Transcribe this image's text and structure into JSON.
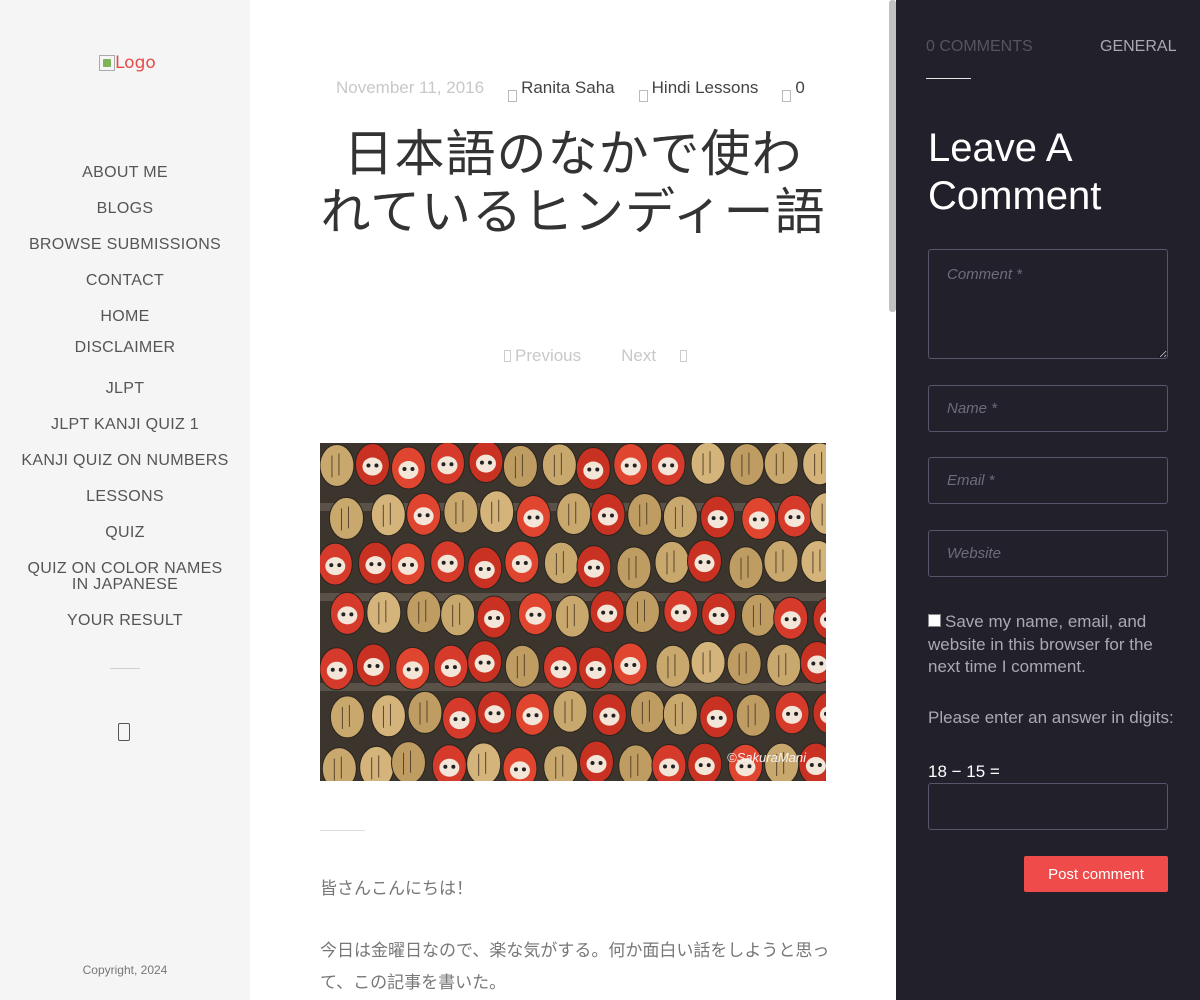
{
  "sidebar": {
    "logo_alt": "Logo",
    "nav": [
      "ABOUT ME",
      "BLOGS",
      "BROWSE SUBMISSIONS",
      "CONTACT",
      "HOME",
      "DISCLAIMER",
      "JLPT",
      "JLPT KANJI QUIZ 1",
      "KANJI QUIZ ON NUMBERS",
      "LESSONS",
      "QUIZ",
      "QUIZ ON COLOR NAMES IN JAPANESE",
      "YOUR RESULT"
    ],
    "icon": "mobile-icon",
    "copyright": "Copyright, 2024"
  },
  "post": {
    "date": "November 11, 2016",
    "author": "Ranita Saha",
    "category": "Hindi Lessons",
    "comment_count": "0",
    "title": "日本語のなかで使われているヒンディー語",
    "nav_previous": "Previous",
    "nav_next": "Next",
    "photo_credit": "©SakuraMani",
    "paragraphs": [
      "皆さんこんにちは！",
      "今日は金曜日なので、楽な気がする。何か面白い話をしようと思って、この記事を書いた。"
    ]
  },
  "panel": {
    "tab_comments": "0 COMMENTS",
    "tab_general": "GENERAL",
    "heading": "Leave A Comment",
    "comment_placeholder": "Comment *",
    "name_placeholder": "Name *",
    "email_placeholder": "Email *",
    "website_placeholder": "Website",
    "consent": "Save my name, email, and website in this browser for the next time I comment.",
    "captcha_label": "Please enter an answer in digits:",
    "captcha_question": "18 − 15 =",
    "submit": "Post comment"
  },
  "colors": {
    "panel_bg": "#22212b",
    "sidebar_bg": "#f5f5f5",
    "accent": "#f04b4b"
  }
}
